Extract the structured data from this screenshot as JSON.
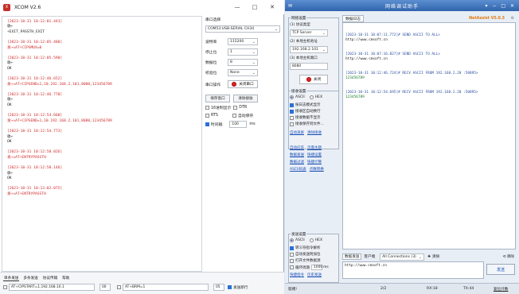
{
  "xcom": {
    "title": "XCOM V2.6",
    "window_buttons": [
      "—",
      "□",
      "✕"
    ],
    "log": [
      {
        "ts": "[2023-10-31 10:12:01.443]",
        "lines": [
          {
            "t": "收←",
            "red": false
          },
          {
            "t": "+EXIT_PASSTH_EXIT",
            "red": false
          }
        ]
      },
      {
        "ts": "[2023-10-31 10:12:05.480]",
        "lines": [
          {
            "t": "发→◇AT+CIPSMUX=0",
            "red": true
          }
        ]
      },
      {
        "ts": "[2023-10-31 10:12:05.590]",
        "lines": [
          {
            "t": "收←",
            "red": false
          },
          {
            "t": "OK",
            "red": false
          }
        ]
      },
      {
        "ts": "[2023-10-31 10:12:46.652]",
        "lines": [
          {
            "t": "发→◇AT+CIPSEND=1,10.192.168.2.101,8080,123456789",
            "red": true
          }
        ]
      },
      {
        "ts": "[2023-10-31 10:12:46.770]",
        "lines": [
          {
            "t": "收←",
            "red": false
          },
          {
            "t": "OK",
            "red": false
          }
        ]
      },
      {
        "ts": "[2023-10-31 10:12:54.660]",
        "lines": [
          {
            "t": "发→◇AT+CIPSEND=1,10.192.168.2.101,8080,123456789",
            "red": true
          }
        ]
      },
      {
        "ts": "[2023-10-31 10:12:54.773]",
        "lines": [
          {
            "t": "收←",
            "red": false
          },
          {
            "t": "OK",
            "red": false
          }
        ]
      },
      {
        "ts": "[2023-10-31 10:12:58.026]",
        "lines": [
          {
            "t": "发→◇AT+ENTRYPASSTH",
            "red": true
          }
        ]
      },
      {
        "ts": "[2023-10-31 10:12:58.146]",
        "lines": [
          {
            "t": "收←",
            "red": false
          },
          {
            "t": "OK",
            "red": false
          }
        ]
      },
      {
        "ts": "[2023-10-31 10:13:02.075]",
        "lines": [
          {
            "t": "发→◇AT+ENTRYPASSTH",
            "red": true
          }
        ]
      }
    ],
    "panel": {
      "port_label": "串口选择",
      "port_value": "COM53:USB-SERIAL CH34",
      "baud_label": "波特率",
      "baud_value": "115200",
      "stop_label": "停止位",
      "stop_value": "1",
      "data_label": "数据位",
      "data_value": "8",
      "parity_label": "校验位",
      "parity_value": "None",
      "op_label": "串口操作",
      "close_port": "关闭串口",
      "save_window": "保存窗口",
      "clear_recv": "清除接收",
      "hex_display": "16进制显示",
      "dtr": "DTR",
      "rts": "RTS",
      "auto_save": "自动保存",
      "timestamp": "时间戳",
      "timestamp_ms": "100",
      "ms": "ms"
    },
    "bottom": {
      "tabs": [
        "单条发送",
        "多条发送",
        "协议传输",
        "帮助"
      ],
      "row1_cmd": "AT+CIPSTART=1,192.168.10.1",
      "row1_num": "00",
      "row2_cmd": "AT+BRM=1",
      "row2_num": "05",
      "send_newline": "发送新行"
    }
  },
  "net": {
    "title": "网络调试助手",
    "net_settings": "网络设置",
    "protocol_label": "(1) 协议类型",
    "protocol_value": "TCP Server",
    "local_ip_label": "(2) 本地主机地址",
    "local_ip_value": "192.168.2.101",
    "local_port_label": "(3) 本地主机端口",
    "local_port_value": "8080",
    "close_button": "关闭",
    "recv_settings": "接收设置",
    "ascii": "ASCII",
    "hex": "HEX",
    "recv_opts": [
      "按日志模式显示",
      "接收区自动换行",
      "接收数据不显示",
      "接收保存到文件..."
    ],
    "auto_scroll": "自动滚屏",
    "clear_recv": "清除接收",
    "links": [
      "自动应答",
      "页面主题",
      "数据发送",
      "快捷设置",
      "数据过滤",
      "快捷计算",
      "ASCII码表",
      "点数转换"
    ],
    "send_settings": "发送设置",
    "send_opts": [
      "转义符指令解析",
      "自动发送附加位",
      "打开文件数据源",
      "循环周期"
    ],
    "cycle_ms": "1000",
    "ms": "ms",
    "quick_cmd": "快捷指令",
    "history": "历史发送",
    "recv_log_label": "数据日志",
    "brand": "NetAssist V5.0.3",
    "recv_entries": [
      {
        "h": "[2023-10-31 10:07:11.772]# SEND ASCII TO ALL>",
        "b": "http://www.cmsoft.cn",
        "blk": true
      },
      {
        "h": "[2023-10-31 10:07:16.827]# SEND ASCII TO ALL>",
        "b": "http://www.cmsoft.cn",
        "blk": true
      },
      {
        "h": "[2023-10-31 10:12:46.724]# RECV ASCII FROM 192.168.2.20 :50895>",
        "b": "123456789",
        "blk": false
      },
      {
        "h": "[2023-10-31 10:12:54.695]# RECV ASCII FROM 192.168.2.20 :50895>",
        "b": "123456789",
        "blk": false
      }
    ],
    "send_tab1": "数据发送",
    "send_tab2": "客户端",
    "connections": "All Connections (3)",
    "clear_send": "清除",
    "clear_recv2": "清除",
    "send_text": "http://www.cmsoft.cn",
    "send_button": "发送",
    "status_ready": "就绪!",
    "status_count": "2/2",
    "rx": "RX:18",
    "tx": "TX:44",
    "reset": "复位计数"
  }
}
